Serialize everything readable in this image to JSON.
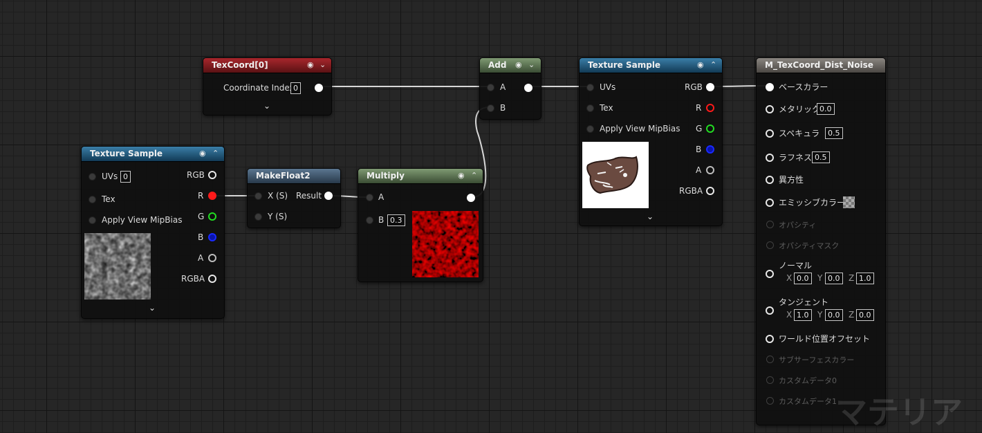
{
  "nodes": {
    "texcoord": {
      "title": "TexCoord[0]",
      "coordinate_index_label": "Coordinate Index",
      "coordinate_index_value": "0"
    },
    "texture_sample_left": {
      "title": "Texture Sample",
      "inputs": {
        "uvs": "UVs",
        "uvs_value": "0",
        "tex": "Tex",
        "mip": "Apply View MipBias"
      },
      "outputs": {
        "rgb": "RGB",
        "r": "R",
        "g": "G",
        "b": "B",
        "a": "A",
        "rgba": "RGBA"
      }
    },
    "makefloat2": {
      "title": "MakeFloat2",
      "x": "X (S)",
      "y": "Y (S)",
      "result": "Result"
    },
    "multiply": {
      "title": "Multiply",
      "a": "A",
      "b": "B",
      "b_value": "0.3"
    },
    "add": {
      "title": "Add",
      "a": "A",
      "b": "B"
    },
    "texture_sample_right": {
      "title": "Texture Sample",
      "inputs": {
        "uvs": "UVs",
        "tex": "Tex",
        "mip": "Apply View MipBias"
      },
      "outputs": {
        "rgb": "RGB",
        "r": "R",
        "g": "G",
        "b": "B",
        "a": "A",
        "rgba": "RGBA"
      }
    },
    "material": {
      "title": "M_TexCoord_Dist_Noise",
      "base_color": "ベースカラー",
      "metallic": "メタリック",
      "metallic_value": "0.0",
      "specular": "スペキュラ",
      "specular_value": "0.5",
      "roughness": "ラフネス",
      "roughness_value": "0.5",
      "anisotropy": "異方性",
      "emissive": "エミッシブカラー",
      "opacity": "オパシティ",
      "opacity_mask": "オパシティマスク",
      "normal": "ノーマル",
      "normal_x": "0.0",
      "normal_y": "0.0",
      "normal_z": "1.0",
      "tangent": "タンジェント",
      "tangent_x": "1.0",
      "tangent_y": "0.0",
      "tangent_z": "0.0",
      "axis_x": "X",
      "axis_y": "Y",
      "axis_z": "Z",
      "world_offset": "ワールド位置オフセット",
      "subsurface": "サブサーフェスカラー",
      "custom0": "カスタムデータ0",
      "custom1": "カスタムデータ1"
    }
  },
  "watermark": "マテリア",
  "colors": {
    "texcoord_header": "#a8262c",
    "texture_header": "#3a7ea8",
    "math_header": "#7f9a73",
    "makefloat_header": "#5b7690",
    "material_header": "#8a8580"
  }
}
